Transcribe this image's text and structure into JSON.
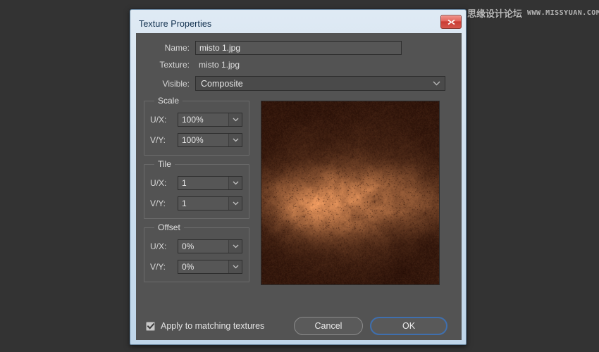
{
  "watermark": {
    "chinese": "思缘设计论坛",
    "english": "WWW.MISSYUAN.COM"
  },
  "dialog": {
    "title": "Texture Properties",
    "close_icon": "close-icon",
    "fields": {
      "name_label": "Name:",
      "name_value": "misto 1.jpg",
      "name_placeholder": "",
      "texture_label": "Texture:",
      "texture_value": "misto 1.jpg",
      "visible_label": "Visible:",
      "visible_value": "Composite",
      "visible_options": [
        "Composite"
      ]
    },
    "groups": [
      {
        "title": "Scale",
        "rows": [
          {
            "label": "U/X:",
            "value": "100%"
          },
          {
            "label": "V/Y:",
            "value": "100%"
          }
        ]
      },
      {
        "title": "Tile",
        "rows": [
          {
            "label": "U/X:",
            "value": "1"
          },
          {
            "label": "V/Y:",
            "value": "1"
          }
        ]
      },
      {
        "title": "Offset",
        "rows": [
          {
            "label": "U/X:",
            "value": "0%"
          },
          {
            "label": "V/Y:",
            "value": "0%"
          }
        ]
      }
    ],
    "preview": {
      "alt": "texture-preview",
      "description": "rusty orange-brown grunge texture with bright horizontal band"
    },
    "footer": {
      "apply_label": "Apply to matching textures",
      "apply_checked": true,
      "cancel_label": "Cancel",
      "ok_label": "OK"
    }
  },
  "colors": {
    "panel_bg": "#535353",
    "desktop_bg": "#333333",
    "dialog_frame": "#cfe0ef",
    "title_text": "#12314f",
    "close_red": "#c93c33",
    "focus_blue": "#3f6fae",
    "texture_base": "#9a5526"
  }
}
